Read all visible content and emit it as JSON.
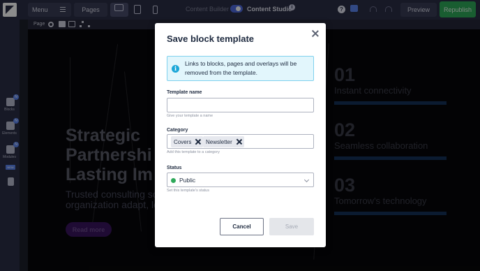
{
  "topbar": {
    "menu_label": "Menu",
    "pages_label": "Pages",
    "content_builder_label": "Content Builder",
    "content_studio_label": "Content Studio",
    "preview_label": "Preview",
    "republish_label": "Republish"
  },
  "left_rail": {
    "items": [
      {
        "label": "Blocks",
        "badge": "N"
      },
      {
        "label": "Elements",
        "badge": "N"
      },
      {
        "label": "Modules",
        "badge": "N",
        "tag": "NEW"
      }
    ]
  },
  "page_strip": {
    "label": "Page"
  },
  "canvas": {
    "hero_title_lines": [
      "Strategic",
      "Partnershi",
      "Lasting Im"
    ],
    "hero_sub_lines": [
      "Trusted consulting so",
      "organization adapt, lea"
    ],
    "read_more_label": "Read more",
    "features": [
      {
        "number": "01",
        "title": "Instant connectivity"
      },
      {
        "number": "02",
        "title": "Seamless collaboration"
      },
      {
        "number": "03",
        "title": "Tomorrow's technology"
      }
    ]
  },
  "modal": {
    "title": "Save block template",
    "info_text": "Links to blocks, pages and overlays will be removed from the template.",
    "template_name": {
      "label": "Template name",
      "value": "",
      "help": "Give your template a name"
    },
    "category": {
      "label": "Category",
      "tags": [
        "Covers",
        "Newsletter"
      ],
      "help": "Add this template to a category"
    },
    "status": {
      "label": "Status",
      "value": "Public",
      "help": "Set this template's status"
    },
    "cancel_label": "Cancel",
    "save_label": "Save"
  },
  "colors": {
    "topbar": "#2b2e45",
    "republish": "#2fa95a",
    "info_box_bg": "#e2f6fc",
    "status_public": "#2fa95a",
    "feature_bar": "#14325a"
  }
}
